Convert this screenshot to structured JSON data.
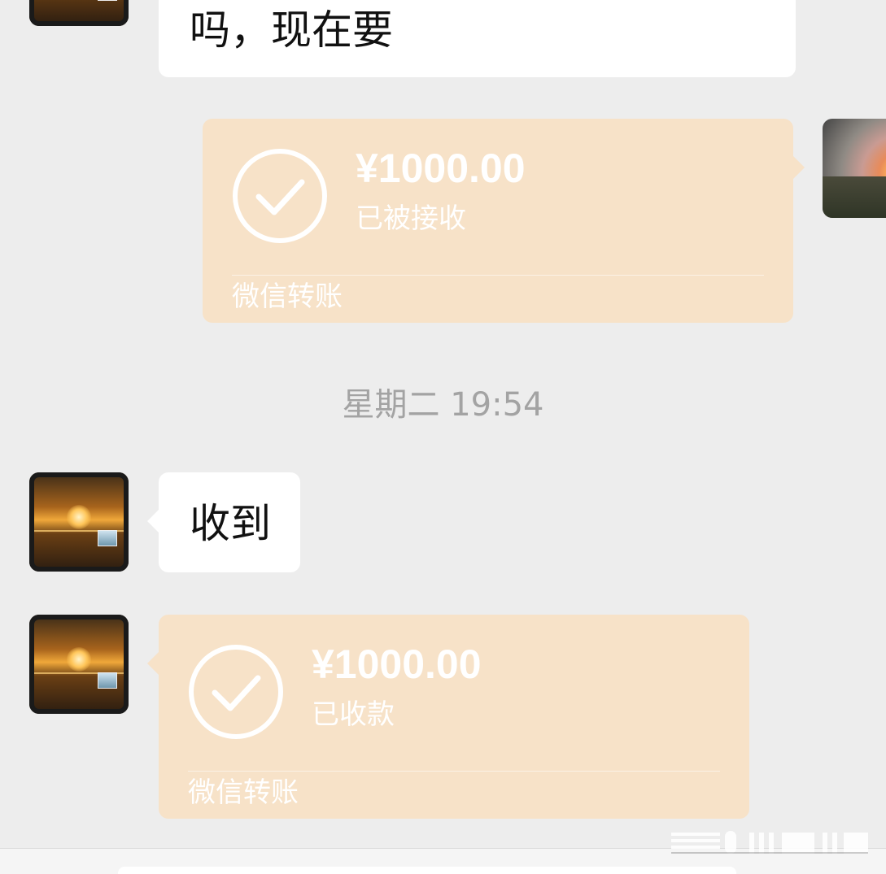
{
  "messages": {
    "partial_text": "吗，现在要",
    "transfer_sent": {
      "amount": "¥1000.00",
      "status": "已被接收",
      "brand": "微信转账"
    },
    "timestamp": "星期二 19:54",
    "reply_text": "收到",
    "transfer_received": {
      "amount": "¥1000.00",
      "status": "已收款",
      "brand": "微信转账"
    }
  },
  "colors": {
    "background": "#ededed",
    "bubble": "#ffffff",
    "transfer_card": "#f7e2c8",
    "timestamp_text": "#a3a3a3"
  },
  "icons": {
    "transfer_status": "check-circle-icon"
  }
}
